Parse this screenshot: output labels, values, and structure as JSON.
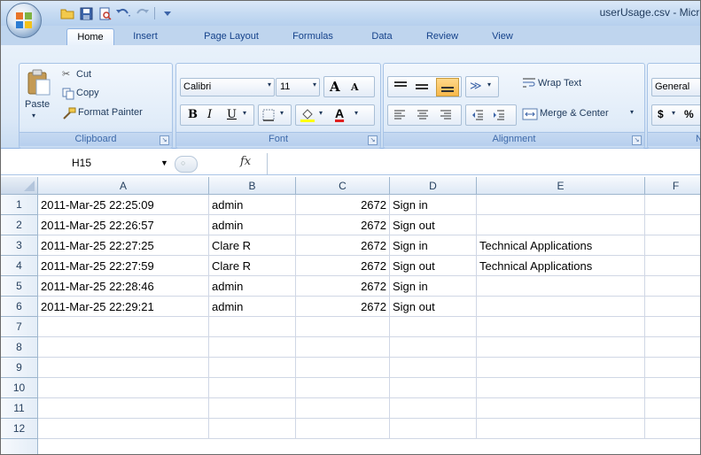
{
  "window": {
    "title": "userUsage.csv - Micro"
  },
  "tabs": [
    "Home",
    "Insert",
    "Page Layout",
    "Formulas",
    "Data",
    "Review",
    "View"
  ],
  "ribbon": {
    "clipboard": {
      "paste": "Paste",
      "cut": "Cut",
      "copy": "Copy",
      "format_painter": "Format Painter",
      "label": "Clipboard"
    },
    "font": {
      "name": "Calibri",
      "size": "11",
      "bold": "B",
      "italic": "I",
      "underline": "U",
      "grow": "A",
      "shrink": "A",
      "font_color": "A",
      "label": "Font"
    },
    "alignment": {
      "wrap_text": "Wrap Text",
      "merge_center": "Merge & Center",
      "label": "Alignment"
    },
    "number": {
      "format": "General",
      "currency": "$",
      "percent": "%",
      "label": "Nu"
    }
  },
  "formula_bar": {
    "name_box": "H15",
    "fx": "fx",
    "value": ""
  },
  "columns": [
    "A",
    "B",
    "C",
    "D",
    "E",
    "F"
  ],
  "rows": [
    {
      "num": "1",
      "A": "2011-Mar-25 22:25:09",
      "B": "admin",
      "C": "2672",
      "D": "Sign in",
      "E": ""
    },
    {
      "num": "2",
      "A": "2011-Mar-25 22:26:57",
      "B": "admin",
      "C": "2672",
      "D": "Sign out",
      "E": ""
    },
    {
      "num": "3",
      "A": "2011-Mar-25 22:27:25",
      "B": "Clare R",
      "C": "2672",
      "D": "Sign in",
      "E": "Technical Applications"
    },
    {
      "num": "4",
      "A": "2011-Mar-25 22:27:59",
      "B": "Clare R",
      "C": "2672",
      "D": "Sign out",
      "E": "Technical Applications"
    },
    {
      "num": "5",
      "A": "2011-Mar-25 22:28:46",
      "B": "admin",
      "C": "2672",
      "D": "Sign in",
      "E": ""
    },
    {
      "num": "6",
      "A": "2011-Mar-25 22:29:21",
      "B": "admin",
      "C": "2672",
      "D": "Sign out",
      "E": ""
    },
    {
      "num": "7",
      "A": "",
      "B": "",
      "C": "",
      "D": "",
      "E": ""
    },
    {
      "num": "8",
      "A": "",
      "B": "",
      "C": "",
      "D": "",
      "E": ""
    },
    {
      "num": "9",
      "A": "",
      "B": "",
      "C": "",
      "D": "",
      "E": ""
    },
    {
      "num": "10",
      "A": "",
      "B": "",
      "C": "",
      "D": "",
      "E": ""
    },
    {
      "num": "11",
      "A": "",
      "B": "",
      "C": "",
      "D": "",
      "E": ""
    },
    {
      "num": "12",
      "A": "",
      "B": "",
      "C": "",
      "D": "",
      "E": ""
    }
  ]
}
